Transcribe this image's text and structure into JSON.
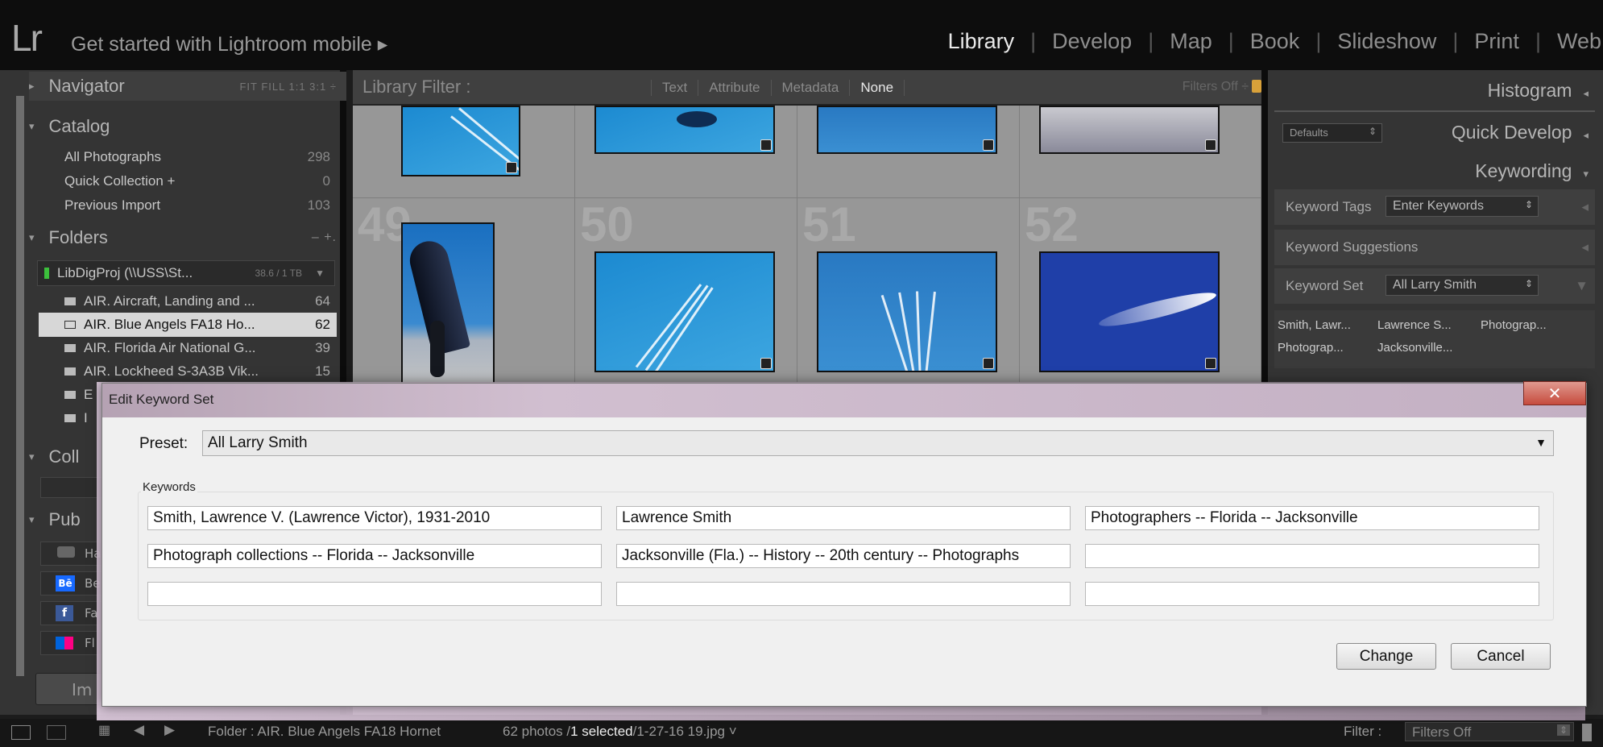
{
  "topbar": {
    "logo": "Lr",
    "get_started": "Get started with Lightroom mobile ▸",
    "modules": [
      "Library",
      "Develop",
      "Map",
      "Book",
      "Slideshow",
      "Print",
      "Web"
    ],
    "active_module": "Library"
  },
  "navigator": {
    "title": "Navigator",
    "zoom_options": "FIT  FILL  1:1  3:1 ÷"
  },
  "catalog": {
    "title": "Catalog",
    "items": [
      {
        "label": "All Photographs",
        "count": "298"
      },
      {
        "label": "Quick Collection +",
        "count": "0"
      },
      {
        "label": "Previous Import",
        "count": "103"
      }
    ]
  },
  "folders": {
    "title": "Folders",
    "controls": "–  +.",
    "volume": {
      "label": "LibDigProj (\\\\USS\\St...",
      "size": "38.6 / 1 TB"
    },
    "items": [
      {
        "label": "AIR. Aircraft, Landing and ...",
        "count": "64"
      },
      {
        "label": "AIR. Blue Angels FA18 Ho...",
        "count": "62"
      },
      {
        "label": "AIR. Florida Air National G...",
        "count": "39"
      },
      {
        "label": "AIR. Lockheed S-3A3B Vik...",
        "count": "15"
      }
    ],
    "partial": [
      "E",
      "I"
    ]
  },
  "collections": {
    "title": "Coll"
  },
  "publish": {
    "title": "Pub",
    "services": [
      "Ha",
      "Be",
      "Fa",
      "Fl"
    ]
  },
  "import_button": "Im",
  "library_filter": {
    "label": "Library Filter :",
    "options": [
      "Text",
      "Attribute",
      "Metadata",
      "None"
    ],
    "selected": "None",
    "filters_state": "Filters Off ÷"
  },
  "grid": {
    "row_numbers": [
      "49",
      "50",
      "51",
      "52"
    ]
  },
  "right_panel": {
    "histogram": "Histogram",
    "preset_dropdown": "Defaults",
    "quick_develop": "Quick Develop",
    "keywording": "Keywording",
    "keyword_tags_label": "Keyword Tags",
    "keyword_tags_value": "Enter Keywords",
    "keyword_suggestions": "Keyword Suggestions",
    "keyword_set_label": "Keyword Set",
    "keyword_set_value": "All Larry Smith",
    "keyword_buttons": [
      "Smith, Lawr...",
      "Lawrence S...",
      "Photograp...",
      "Photograp...",
      "Jacksonville..."
    ]
  },
  "statusbar": {
    "folder": "Folder : AIR. Blue Angels FA18 Hornet",
    "photos": "62 photos /",
    "selected": "1 selected",
    "file": "/1-27-16 19.jpg ˅",
    "filter_label": "Filter :",
    "filter_value": "Filters Off"
  },
  "dialog": {
    "title": "Edit Keyword Set",
    "close": "✕",
    "preset_label": "Preset:",
    "preset_value": "All Larry Smith",
    "keywords_label": "Keywords",
    "keywords": [
      "Smith, Lawrence V. (Lawrence Victor), 1931-2010",
      "Lawrence Smith",
      "Photographers -- Florida -- Jacksonville",
      "Photograph collections -- Florida -- Jacksonville",
      "Jacksonville (Fla.) -- History -- 20th century -- Photographs",
      "",
      "",
      "",
      ""
    ],
    "change_button": "Change",
    "cancel_button": "Cancel"
  }
}
